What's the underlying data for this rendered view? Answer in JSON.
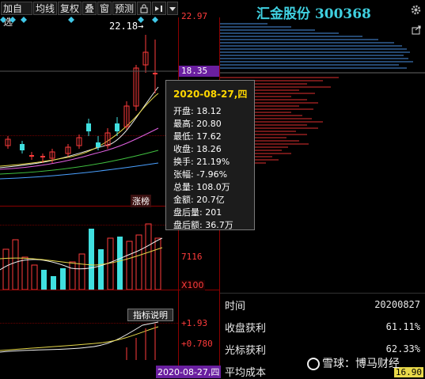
{
  "toolbar": {
    "items": [
      "加自选",
      "均线",
      "复权",
      "叠",
      "窗",
      "预测"
    ],
    "lock_icon": "lock-icon",
    "arrow_icon": "collapse-arrow-icon",
    "menu_icon": "menu-triangle-icon"
  },
  "header": {
    "stock_title": "汇金股份 300368",
    "settings_icon": "gear-icon",
    "export_icon": "export-icon"
  },
  "price_axis": {
    "top": "22.97",
    "current": "18.35",
    "hidden_partial": "18.35"
  },
  "annotations": {
    "high_marker": "22.18",
    "limit_tag": "涨榜",
    "indicator_button": "指标说明",
    "volume_value": "7116",
    "volume_unit": "X100",
    "indicator_up": "+1.93",
    "indicator_val": "+0.780",
    "date_bottom": "2020-08-27,四"
  },
  "tooltip": {
    "date": "2020-08-27,四",
    "rows": [
      {
        "label": "开盘",
        "value": "18.12"
      },
      {
        "label": "最高",
        "value": "20.80"
      },
      {
        "label": "最低",
        "value": "17.62"
      },
      {
        "label": "收盘",
        "value": "18.26"
      },
      {
        "label": "换手",
        "value": "21.19%"
      },
      {
        "label": "张幅",
        "value": "-7.96%"
      },
      {
        "label": "总量",
        "value": "108.0万"
      },
      {
        "label": "金额",
        "value": "20.7亿"
      },
      {
        "label": "盘后量",
        "value": "201"
      },
      {
        "label": "盘后额",
        "value": "36.7万"
      }
    ]
  },
  "stats": {
    "time_label": "时间",
    "time_value": "20200827",
    "profit_label": "收盘获利",
    "profit_value": "61.11%",
    "light_label": "光标获利",
    "light_value": "62.33%",
    "avg_cost_label": "平均成本",
    "avg_cost_value": "16.90"
  },
  "watermark": {
    "text": "雪球：博马财经"
  },
  "colors": {
    "up": "#ff3b3b",
    "down": "#40e0e0",
    "title": "#3fd0e0",
    "chip_upper": "#4a90e2",
    "chip_lower": "#e03030",
    "tooltip_date": "#ffd700"
  }
}
